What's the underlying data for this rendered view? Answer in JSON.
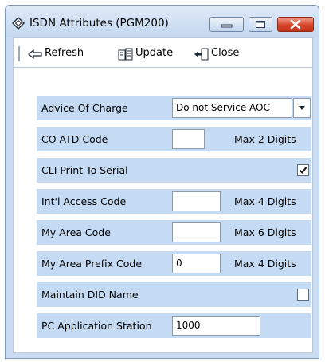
{
  "window": {
    "title": "ISDN Attributes (PGM200)"
  },
  "toolbar": {
    "refresh_label": "Refresh",
    "update_label": "Update",
    "close_label": "Close"
  },
  "form": {
    "advice_of_charge": {
      "label": "Advice Of Charge",
      "value": "Do not Service AOC"
    },
    "co_atd_code": {
      "label": "CO ATD Code",
      "value": "",
      "hint": "Max 2 Digits"
    },
    "cli_print_to_serial": {
      "label": "CLI Print To Serial",
      "checked": true
    },
    "intl_access_code": {
      "label": "Int'l Access Code",
      "value": "",
      "hint": "Max 4 Digits"
    },
    "my_area_code": {
      "label": "My Area Code",
      "value": "",
      "hint": "Max 6 Digits"
    },
    "my_area_prefix_code": {
      "label": "My Area Prefix Code",
      "value": "0",
      "hint": "Max 4 Digits"
    },
    "maintain_did_name": {
      "label": "Maintain DID Name",
      "checked": false
    },
    "pc_application_station": {
      "label": "PC Application Station",
      "value": "1000"
    }
  }
}
